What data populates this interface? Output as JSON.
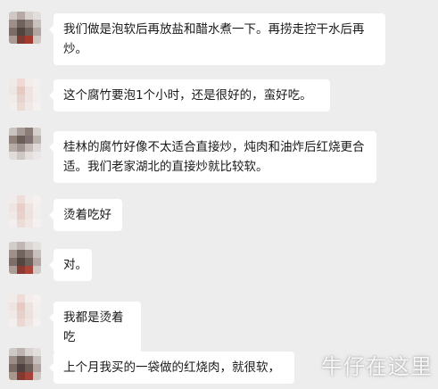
{
  "messages": [
    {
      "text": "我们做是泡软后再放盐和醋水煮一下。再捞走控干水后再炒。",
      "avatar": "blurred-avatar-1"
    },
    {
      "text": "这个腐竹要泡1个小时，还是很好的，蛮好吃。",
      "avatar": "blurred-avatar-2"
    },
    {
      "text": "桂林的腐竹好像不太适合直接炒，炖肉和油炸后红烧更合适。我们老家湖北的直接炒就比较软。",
      "avatar": "blurred-avatar-3"
    },
    {
      "text": "烫着吃好",
      "avatar": "blurred-avatar-4"
    },
    {
      "text": "对。",
      "avatar": "blurred-avatar-5"
    },
    {
      "text": "我都是烫着吃",
      "avatar": "blurred-avatar-6"
    },
    {
      "text": "上个月我买的一袋做的红烧肉，就很软，",
      "avatar": "blurred-avatar-7"
    }
  ],
  "watermark": "牛仔在这里",
  "colors": {
    "background": "#ededed",
    "bubble": "#ffffff",
    "text": "#1a1a1a"
  }
}
